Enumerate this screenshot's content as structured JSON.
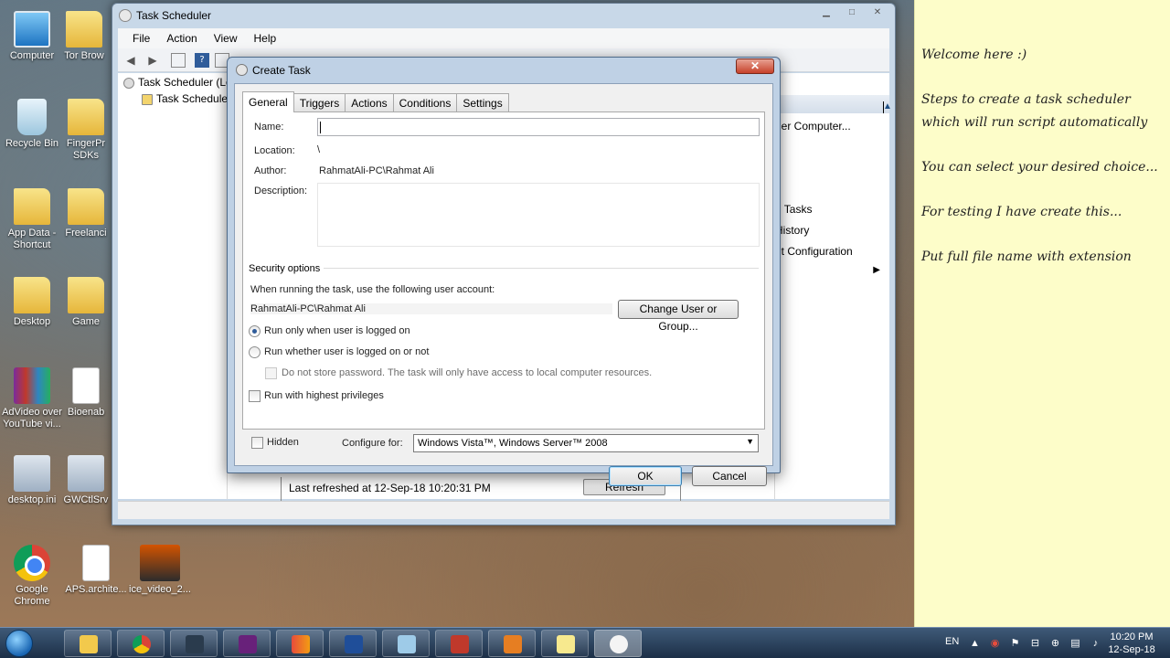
{
  "desktop_icons": [
    {
      "label": "Computer",
      "kind": "computer"
    },
    {
      "label": "Tor Brow",
      "kind": "folder"
    },
    {
      "label": "Recycle Bin",
      "kind": "bin"
    },
    {
      "label": "FingerPr SDKs",
      "kind": "folder"
    },
    {
      "label": "App Data - Shortcut",
      "kind": "folder"
    },
    {
      "label": "Freelanci",
      "kind": "folder"
    },
    {
      "label": "Desktop",
      "kind": "folder"
    },
    {
      "label": "Game",
      "kind": "folder"
    },
    {
      "label": "AdVideo over YouTube vi...",
      "kind": "winrar"
    },
    {
      "label": "Bioenab",
      "kind": "doc"
    },
    {
      "label": "desktop.ini",
      "kind": "app"
    },
    {
      "label": "GWCtlSrv",
      "kind": "app"
    },
    {
      "label": "Google Chrome",
      "kind": "chrome"
    },
    {
      "label": "APS.archite...",
      "kind": "doc"
    },
    {
      "label": "ice_video_2...",
      "kind": "video"
    }
  ],
  "main_window": {
    "title": "Task Scheduler",
    "menu": [
      "File",
      "Action",
      "View",
      "Help"
    ],
    "tree": [
      "Task Scheduler (Lo",
      "Task Scheduler"
    ],
    "actions": [
      "her Computer...",
      "g Tasks",
      "History",
      "nt Configuration"
    ],
    "refresh_text": "Last refreshed at 12-Sep-18 10:20:31 PM",
    "refresh_button": "Refresh"
  },
  "dialog": {
    "title": "Create Task",
    "close_glyph": "✕",
    "tabs": [
      "General",
      "Triggers",
      "Actions",
      "Conditions",
      "Settings"
    ],
    "active_tab": "General",
    "name_label": "Name:",
    "name_value": "",
    "location_label": "Location:",
    "location_value": "\\",
    "author_label": "Author:",
    "author_value": "RahmatAli-PC\\Rahmat Ali",
    "description_label": "Description:",
    "security": {
      "title": "Security options",
      "account_prompt": "When running the task, use the following user account:",
      "account": "RahmatAli-PC\\Rahmat Ali",
      "change_button": "Change User or Group...",
      "radio_logged_on": "Run only when user is logged on",
      "radio_whether": "Run whether user is logged on or not",
      "no_store_password": "Do not store password.  The task will only have access to local computer resources.",
      "highest_privileges": "Run with highest privileges",
      "selected_radio": "logged_on"
    },
    "hidden_label": "Hidden",
    "configure_label": "Configure for:",
    "configure_value": "Windows Vista™, Windows Server™ 2008",
    "ok_button": "OK",
    "cancel_button": "Cancel"
  },
  "sticky_note": {
    "lines": [
      "Welcome here :)",
      "Steps to create a task scheduler which will run script automatically",
      "You can select your desired choice...",
      "For testing I have create this...",
      "Put full file name with extension"
    ]
  },
  "taskbar": {
    "language": "EN",
    "time": "10:20 PM",
    "date": "12-Sep-18"
  }
}
